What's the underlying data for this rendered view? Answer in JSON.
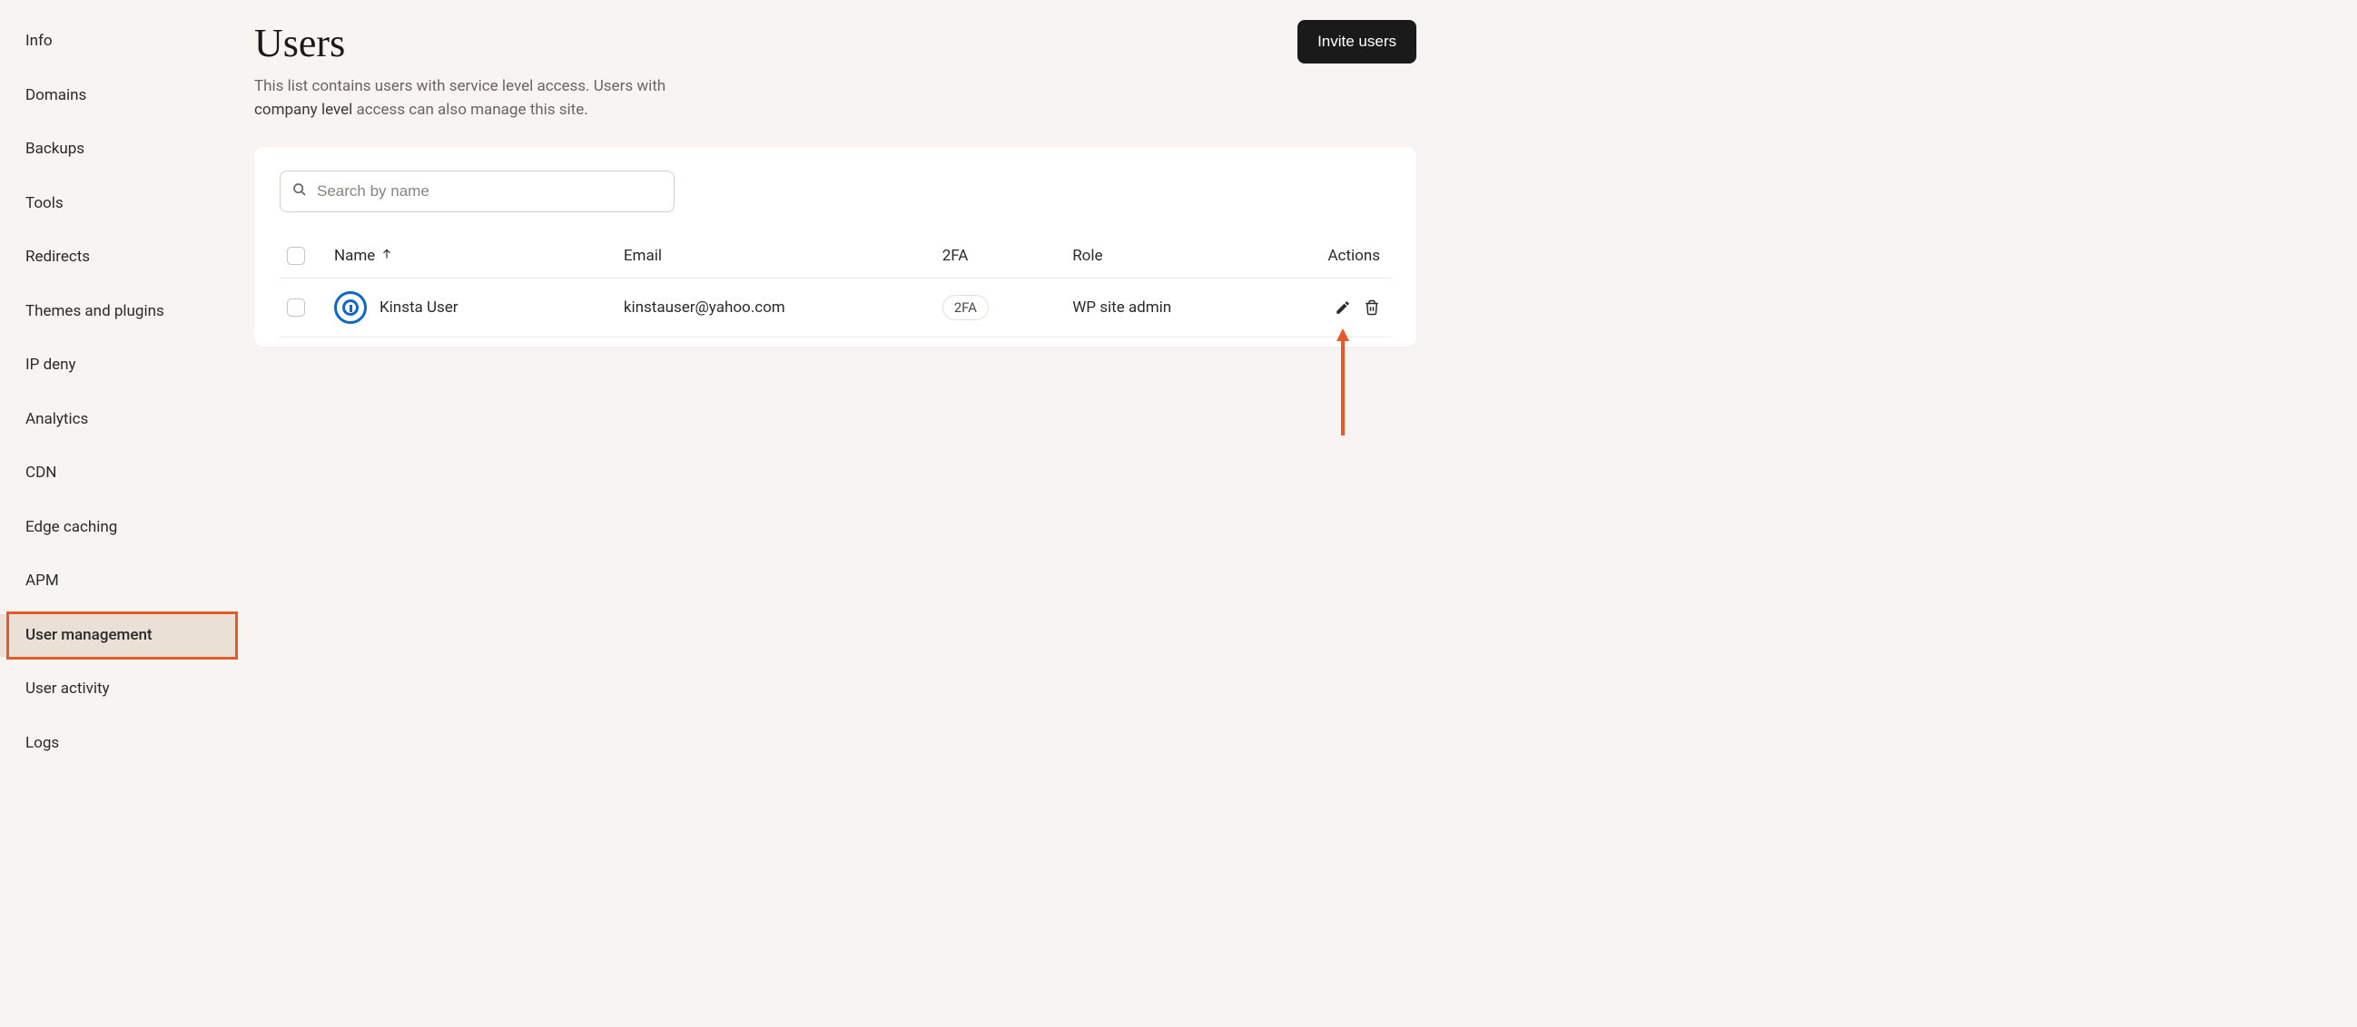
{
  "sidebar": {
    "items": [
      {
        "label": "Info"
      },
      {
        "label": "Domains"
      },
      {
        "label": "Backups"
      },
      {
        "label": "Tools"
      },
      {
        "label": "Redirects"
      },
      {
        "label": "Themes and plugins"
      },
      {
        "label": "IP deny"
      },
      {
        "label": "Analytics"
      },
      {
        "label": "CDN"
      },
      {
        "label": "Edge caching"
      },
      {
        "label": "APM"
      },
      {
        "label": "User management"
      },
      {
        "label": "User activity"
      },
      {
        "label": "Logs"
      }
    ],
    "active_index": 11
  },
  "header": {
    "title": "Users",
    "invite_label": "Invite users"
  },
  "subtitle": {
    "pre": "This list contains users with service level access. Users with ",
    "link": "company level",
    "post": " access can also manage this site."
  },
  "search": {
    "placeholder": "Search by name"
  },
  "table": {
    "columns": {
      "name": "Name",
      "email": "Email",
      "twofa": "2FA",
      "role": "Role",
      "actions": "Actions"
    },
    "rows": [
      {
        "name": "Kinsta User",
        "email": "kinstauser@yahoo.com",
        "twofa": "2FA",
        "role": "WP site admin"
      }
    ]
  }
}
